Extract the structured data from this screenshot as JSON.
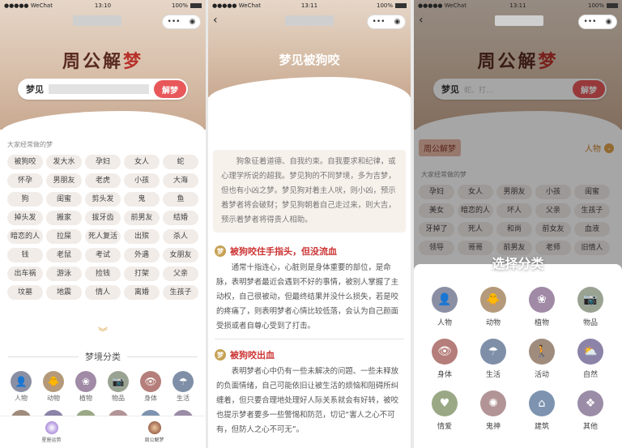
{
  "status": {
    "carrier": "●●●●● WeChat",
    "battery": "100%"
  },
  "phone1": {
    "time": "13:10",
    "brand_a": "周公解",
    "brand_b": "梦",
    "search_label": "梦见",
    "search_button": "解梦",
    "popular_title": "大家经常做的梦",
    "tags": [
      "被狗咬",
      "发大水",
      "孕妇",
      "女人",
      "蛇",
      "怀孕",
      "男朋友",
      "老虎",
      "小孩",
      "大海",
      "狗",
      "闺蜜",
      "剪头发",
      "鬼",
      "鱼",
      "掉头发",
      "搬家",
      "拔牙齿",
      "前男友",
      "结婚",
      "暗恋的人",
      "拉屎",
      "死人复活",
      "出殡",
      "杀人",
      "钱",
      "老鼠",
      "考试",
      "外遇",
      "女朋友",
      "出车祸",
      "游泳",
      "捡钱",
      "打架",
      "父亲",
      "坟墓",
      "地震",
      "情人",
      "离婚",
      "生孩子"
    ],
    "more_icon": "chevron-double-down",
    "category_title": "梦境分类",
    "categories": [
      "人物",
      "动物",
      "植物",
      "物品",
      "身体",
      "生活"
    ],
    "tabs": [
      "星座运势",
      "周公解梦"
    ]
  },
  "phone2": {
    "time": "13:11",
    "title": "梦见被狗咬",
    "intro": "狗象征着道德、自我约束。自我要求和纪律，或心理学所说的超我。梦见狗的不同梦境，多为吉梦，但也有小凶之梦。梦见狗对着主人吠，则小凶，预示着梦者将会破财；梦见狗朝着自己走过来，则大吉，预示着梦者将得贵人相助。",
    "s1_title": "被狗咬住手指头，但没流血",
    "s1_body": "通常十指连心，心脏则是身体重要的部位，是命脉，表明梦者最近会遇到不好的事情，被别人掌握了主动权，自己很被动，但最终结果并没什么损失，若是咬的疼痛了，则表明梦者心情比较低落，会认为自己颜面受损或者自尊心受到了打击。",
    "s2_title": "被狗咬出血",
    "s2_body": "表明梦者心中仍有一些未解决的问题、一些未释放的负面情绪，自己可能依旧让被生活的烦恼和阻碍所纠缠着，但只要合理地处理好人际关系就会有好转，被咬也提示梦者要多一些警惕和防范，切记“害人之心不可有，但防人之心不可无”。"
  },
  "phone3": {
    "time": "13:11",
    "brand_a": "周公解",
    "brand_b": "梦",
    "search_label": "梦见",
    "search_placeholder": "蛇、打…",
    "search_button": "解梦",
    "chip": "周公解梦",
    "filter": "人物",
    "popular_title": "大家经常做的梦",
    "tags": [
      "孕妇",
      "女人",
      "男朋友",
      "小孩",
      "闺蜜",
      "美女",
      "暗恋的人",
      "坏人",
      "父亲",
      "生孩子",
      "牙掉了",
      "死人",
      "和尚",
      "前女友",
      "血液",
      "领导",
      "哥哥",
      "前男友",
      "老师",
      "旧情人"
    ],
    "sheet_title": "选择分类",
    "categories": [
      {
        "label": "人物",
        "color": "#8a8fa3",
        "glyph": "👤"
      },
      {
        "label": "动物",
        "color": "#b49a7a",
        "glyph": "🐥"
      },
      {
        "label": "植物",
        "color": "#a08aa6",
        "glyph": "❀"
      },
      {
        "label": "物品",
        "color": "#9aa392",
        "glyph": "📷"
      },
      {
        "label": "身体",
        "color": "#b57e7a",
        "glyph": "👁"
      },
      {
        "label": "生活",
        "color": "#7f8fa8",
        "glyph": "☂"
      },
      {
        "label": "活动",
        "color": "#a08c7d",
        "glyph": "🚶"
      },
      {
        "label": "自然",
        "color": "#8c83a8",
        "glyph": "⛅"
      },
      {
        "label": "情爱",
        "color": "#9aa886",
        "glyph": "♥"
      },
      {
        "label": "鬼神",
        "color": "#b29496",
        "glyph": "✺"
      },
      {
        "label": "建筑",
        "color": "#7d93b0",
        "glyph": "⌂"
      },
      {
        "label": "其他",
        "color": "#9b8ca7",
        "glyph": "❖"
      }
    ]
  }
}
